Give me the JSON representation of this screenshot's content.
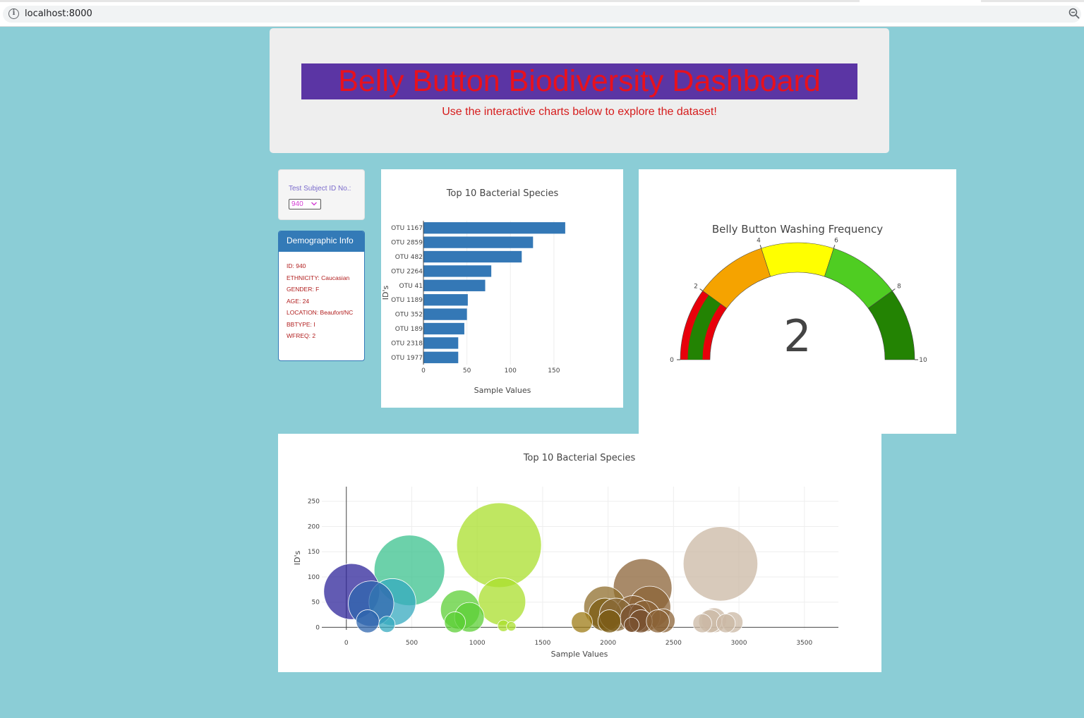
{
  "browser": {
    "url": "localhost:8000",
    "info_icon": "i"
  },
  "header": {
    "title": "Belly Button Biodiversity Dashboard",
    "subtitle": "Use the interactive charts below to explore the dataset!"
  },
  "selector": {
    "label": "Test Subject ID No.:",
    "selected": "940"
  },
  "demographics": {
    "heading": "Demographic Info",
    "lines": [
      "ID: 940",
      "ETHNICITY: Caucasian",
      "GENDER: F",
      "AGE: 24",
      "LOCATION: Beaufort/NC",
      "BBTYPE: I",
      "WFREQ: 2"
    ]
  },
  "colors": {
    "page_bg": "#8bcdd6",
    "bar": "#3478b6",
    "title_bg": "#5b35a4",
    "title_fg": "#e8111d"
  },
  "chart_data": [
    {
      "type": "bar",
      "orientation": "horizontal",
      "title": "Top 10 Bacterial Species",
      "xlabel": "Sample Values",
      "ylabel": "ID's",
      "categories": [
        "OTU 1167",
        "OTU 2859",
        "OTU 482",
        "OTU 2264",
        "OTU 41",
        "OTU 1189",
        "OTU 352",
        "OTU 189",
        "OTU 2318",
        "OTU 1977"
      ],
      "values": [
        163,
        126,
        113,
        78,
        71,
        51,
        50,
        47,
        40,
        40
      ],
      "xticks": [
        0,
        50,
        100,
        150
      ],
      "xlim": [
        0,
        172
      ],
      "grid": true
    },
    {
      "type": "gauge",
      "title": "Belly Button Washing Frequency",
      "value": 2,
      "range": [
        0,
        10
      ],
      "ticks": [
        0,
        2,
        4,
        6,
        8,
        10
      ],
      "steps": [
        {
          "range": [
            0,
            2
          ],
          "color": "#e8000b"
        },
        {
          "range": [
            2,
            4
          ],
          "color": "#f5a300"
        },
        {
          "range": [
            4,
            6
          ],
          "color": "#ffff00"
        },
        {
          "range": [
            6,
            8
          ],
          "color": "#4fcd22"
        },
        {
          "range": [
            8,
            10
          ],
          "color": "#238303"
        }
      ],
      "bar_color": "#238303"
    },
    {
      "type": "scatter",
      "subtype": "bubble",
      "title": "Top 10 Bacterial Species",
      "xlabel": "Sample Values",
      "ylabel": "ID's",
      "xticks": [
        0,
        500,
        1000,
        1500,
        2000,
        2500,
        3000,
        3500
      ],
      "yticks": [
        0,
        50,
        100,
        150,
        200,
        250
      ],
      "xlim": [
        -360,
        3760
      ],
      "ylim": [
        -5,
        300
      ],
      "grid": true,
      "points": [
        {
          "x": 41,
          "y": 71,
          "color": "#2e249a"
        },
        {
          "x": 189,
          "y": 47,
          "color": "#2f66ad"
        },
        {
          "x": 163,
          "y": 12,
          "color": "#2f66ad"
        },
        {
          "x": 352,
          "y": 50,
          "color": "#36a9bf"
        },
        {
          "x": 310,
          "y": 6,
          "color": "#36a9bf"
        },
        {
          "x": 482,
          "y": 113,
          "color": "#3bc28e"
        },
        {
          "x": 870,
          "y": 35,
          "color": "#5ccf35"
        },
        {
          "x": 940,
          "y": 20,
          "color": "#5ccf35"
        },
        {
          "x": 830,
          "y": 10,
          "color": "#5ccf35"
        },
        {
          "x": 1167,
          "y": 163,
          "color": "#a9df2c"
        },
        {
          "x": 1189,
          "y": 51,
          "color": "#a9df2c"
        },
        {
          "x": 1200,
          "y": 3,
          "color": "#a9df2c"
        },
        {
          "x": 1260,
          "y": 2,
          "color": "#a9df2c"
        },
        {
          "x": 1800,
          "y": 10,
          "color": "#9d7b16"
        },
        {
          "x": 1975,
          "y": 40,
          "color": "#8f6d2c"
        },
        {
          "x": 1977,
          "y": 25,
          "color": "#7a5a10"
        },
        {
          "x": 2010,
          "y": 12,
          "color": "#7a5a10"
        },
        {
          "x": 2060,
          "y": 25,
          "color": "#8a6a3a"
        },
        {
          "x": 2264,
          "y": 78,
          "color": "#8b6337"
        },
        {
          "x": 2190,
          "y": 28,
          "color": "#8b6337"
        },
        {
          "x": 2200,
          "y": 18,
          "color": "#7a5230"
        },
        {
          "x": 2318,
          "y": 40,
          "color": "#8b6337"
        },
        {
          "x": 2280,
          "y": 22,
          "color": "#8b6337"
        },
        {
          "x": 2250,
          "y": 12,
          "color": "#7a5230"
        },
        {
          "x": 2180,
          "y": 5,
          "color": "#7a5230"
        },
        {
          "x": 2380,
          "y": 12,
          "color": "#8b6337"
        },
        {
          "x": 2420,
          "y": 13,
          "color": "#8b6337"
        },
        {
          "x": 2859,
          "y": 126,
          "color": "#cbb8a4"
        },
        {
          "x": 2720,
          "y": 8,
          "color": "#cbb8a4"
        },
        {
          "x": 2780,
          "y": 12,
          "color": "#cbb8a4"
        },
        {
          "x": 2810,
          "y": 14,
          "color": "#cbb8a4"
        },
        {
          "x": 2900,
          "y": 8,
          "color": "#cbb8a4"
        },
        {
          "x": 2950,
          "y": 10,
          "color": "#cbb8a4"
        }
      ]
    }
  ]
}
